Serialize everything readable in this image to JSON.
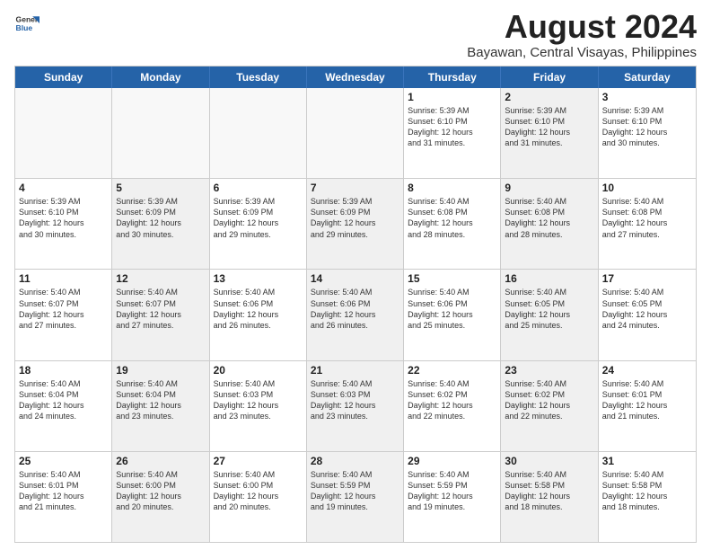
{
  "header": {
    "logo_line1": "General",
    "logo_line2": "Blue",
    "title": "August 2024",
    "subtitle": "Bayawan, Central Visayas, Philippines"
  },
  "days_of_week": [
    "Sunday",
    "Monday",
    "Tuesday",
    "Wednesday",
    "Thursday",
    "Friday",
    "Saturday"
  ],
  "weeks": [
    [
      {
        "day": "",
        "lines": [],
        "shaded": false,
        "empty": true
      },
      {
        "day": "",
        "lines": [],
        "shaded": false,
        "empty": true
      },
      {
        "day": "",
        "lines": [],
        "shaded": false,
        "empty": true
      },
      {
        "day": "",
        "lines": [],
        "shaded": false,
        "empty": true
      },
      {
        "day": "1",
        "lines": [
          "Sunrise: 5:39 AM",
          "Sunset: 6:10 PM",
          "Daylight: 12 hours",
          "and 31 minutes."
        ],
        "shaded": false,
        "empty": false
      },
      {
        "day": "2",
        "lines": [
          "Sunrise: 5:39 AM",
          "Sunset: 6:10 PM",
          "Daylight: 12 hours",
          "and 31 minutes."
        ],
        "shaded": true,
        "empty": false
      },
      {
        "day": "3",
        "lines": [
          "Sunrise: 5:39 AM",
          "Sunset: 6:10 PM",
          "Daylight: 12 hours",
          "and 30 minutes."
        ],
        "shaded": false,
        "empty": false
      }
    ],
    [
      {
        "day": "4",
        "lines": [
          "Sunrise: 5:39 AM",
          "Sunset: 6:10 PM",
          "Daylight: 12 hours",
          "and 30 minutes."
        ],
        "shaded": false,
        "empty": false
      },
      {
        "day": "5",
        "lines": [
          "Sunrise: 5:39 AM",
          "Sunset: 6:09 PM",
          "Daylight: 12 hours",
          "and 30 minutes."
        ],
        "shaded": true,
        "empty": false
      },
      {
        "day": "6",
        "lines": [
          "Sunrise: 5:39 AM",
          "Sunset: 6:09 PM",
          "Daylight: 12 hours",
          "and 29 minutes."
        ],
        "shaded": false,
        "empty": false
      },
      {
        "day": "7",
        "lines": [
          "Sunrise: 5:39 AM",
          "Sunset: 6:09 PM",
          "Daylight: 12 hours",
          "and 29 minutes."
        ],
        "shaded": true,
        "empty": false
      },
      {
        "day": "8",
        "lines": [
          "Sunrise: 5:40 AM",
          "Sunset: 6:08 PM",
          "Daylight: 12 hours",
          "and 28 minutes."
        ],
        "shaded": false,
        "empty": false
      },
      {
        "day": "9",
        "lines": [
          "Sunrise: 5:40 AM",
          "Sunset: 6:08 PM",
          "Daylight: 12 hours",
          "and 28 minutes."
        ],
        "shaded": true,
        "empty": false
      },
      {
        "day": "10",
        "lines": [
          "Sunrise: 5:40 AM",
          "Sunset: 6:08 PM",
          "Daylight: 12 hours",
          "and 27 minutes."
        ],
        "shaded": false,
        "empty": false
      }
    ],
    [
      {
        "day": "11",
        "lines": [
          "Sunrise: 5:40 AM",
          "Sunset: 6:07 PM",
          "Daylight: 12 hours",
          "and 27 minutes."
        ],
        "shaded": false,
        "empty": false
      },
      {
        "day": "12",
        "lines": [
          "Sunrise: 5:40 AM",
          "Sunset: 6:07 PM",
          "Daylight: 12 hours",
          "and 27 minutes."
        ],
        "shaded": true,
        "empty": false
      },
      {
        "day": "13",
        "lines": [
          "Sunrise: 5:40 AM",
          "Sunset: 6:06 PM",
          "Daylight: 12 hours",
          "and 26 minutes."
        ],
        "shaded": false,
        "empty": false
      },
      {
        "day": "14",
        "lines": [
          "Sunrise: 5:40 AM",
          "Sunset: 6:06 PM",
          "Daylight: 12 hours",
          "and 26 minutes."
        ],
        "shaded": true,
        "empty": false
      },
      {
        "day": "15",
        "lines": [
          "Sunrise: 5:40 AM",
          "Sunset: 6:06 PM",
          "Daylight: 12 hours",
          "and 25 minutes."
        ],
        "shaded": false,
        "empty": false
      },
      {
        "day": "16",
        "lines": [
          "Sunrise: 5:40 AM",
          "Sunset: 6:05 PM",
          "Daylight: 12 hours",
          "and 25 minutes."
        ],
        "shaded": true,
        "empty": false
      },
      {
        "day": "17",
        "lines": [
          "Sunrise: 5:40 AM",
          "Sunset: 6:05 PM",
          "Daylight: 12 hours",
          "and 24 minutes."
        ],
        "shaded": false,
        "empty": false
      }
    ],
    [
      {
        "day": "18",
        "lines": [
          "Sunrise: 5:40 AM",
          "Sunset: 6:04 PM",
          "Daylight: 12 hours",
          "and 24 minutes."
        ],
        "shaded": false,
        "empty": false
      },
      {
        "day": "19",
        "lines": [
          "Sunrise: 5:40 AM",
          "Sunset: 6:04 PM",
          "Daylight: 12 hours",
          "and 23 minutes."
        ],
        "shaded": true,
        "empty": false
      },
      {
        "day": "20",
        "lines": [
          "Sunrise: 5:40 AM",
          "Sunset: 6:03 PM",
          "Daylight: 12 hours",
          "and 23 minutes."
        ],
        "shaded": false,
        "empty": false
      },
      {
        "day": "21",
        "lines": [
          "Sunrise: 5:40 AM",
          "Sunset: 6:03 PM",
          "Daylight: 12 hours",
          "and 23 minutes."
        ],
        "shaded": true,
        "empty": false
      },
      {
        "day": "22",
        "lines": [
          "Sunrise: 5:40 AM",
          "Sunset: 6:02 PM",
          "Daylight: 12 hours",
          "and 22 minutes."
        ],
        "shaded": false,
        "empty": false
      },
      {
        "day": "23",
        "lines": [
          "Sunrise: 5:40 AM",
          "Sunset: 6:02 PM",
          "Daylight: 12 hours",
          "and 22 minutes."
        ],
        "shaded": true,
        "empty": false
      },
      {
        "day": "24",
        "lines": [
          "Sunrise: 5:40 AM",
          "Sunset: 6:01 PM",
          "Daylight: 12 hours",
          "and 21 minutes."
        ],
        "shaded": false,
        "empty": false
      }
    ],
    [
      {
        "day": "25",
        "lines": [
          "Sunrise: 5:40 AM",
          "Sunset: 6:01 PM",
          "Daylight: 12 hours",
          "and 21 minutes."
        ],
        "shaded": false,
        "empty": false
      },
      {
        "day": "26",
        "lines": [
          "Sunrise: 5:40 AM",
          "Sunset: 6:00 PM",
          "Daylight: 12 hours",
          "and 20 minutes."
        ],
        "shaded": true,
        "empty": false
      },
      {
        "day": "27",
        "lines": [
          "Sunrise: 5:40 AM",
          "Sunset: 6:00 PM",
          "Daylight: 12 hours",
          "and 20 minutes."
        ],
        "shaded": false,
        "empty": false
      },
      {
        "day": "28",
        "lines": [
          "Sunrise: 5:40 AM",
          "Sunset: 5:59 PM",
          "Daylight: 12 hours",
          "and 19 minutes."
        ],
        "shaded": true,
        "empty": false
      },
      {
        "day": "29",
        "lines": [
          "Sunrise: 5:40 AM",
          "Sunset: 5:59 PM",
          "Daylight: 12 hours",
          "and 19 minutes."
        ],
        "shaded": false,
        "empty": false
      },
      {
        "day": "30",
        "lines": [
          "Sunrise: 5:40 AM",
          "Sunset: 5:58 PM",
          "Daylight: 12 hours",
          "and 18 minutes."
        ],
        "shaded": true,
        "empty": false
      },
      {
        "day": "31",
        "lines": [
          "Sunrise: 5:40 AM",
          "Sunset: 5:58 PM",
          "Daylight: 12 hours",
          "and 18 minutes."
        ],
        "shaded": false,
        "empty": false
      }
    ]
  ]
}
